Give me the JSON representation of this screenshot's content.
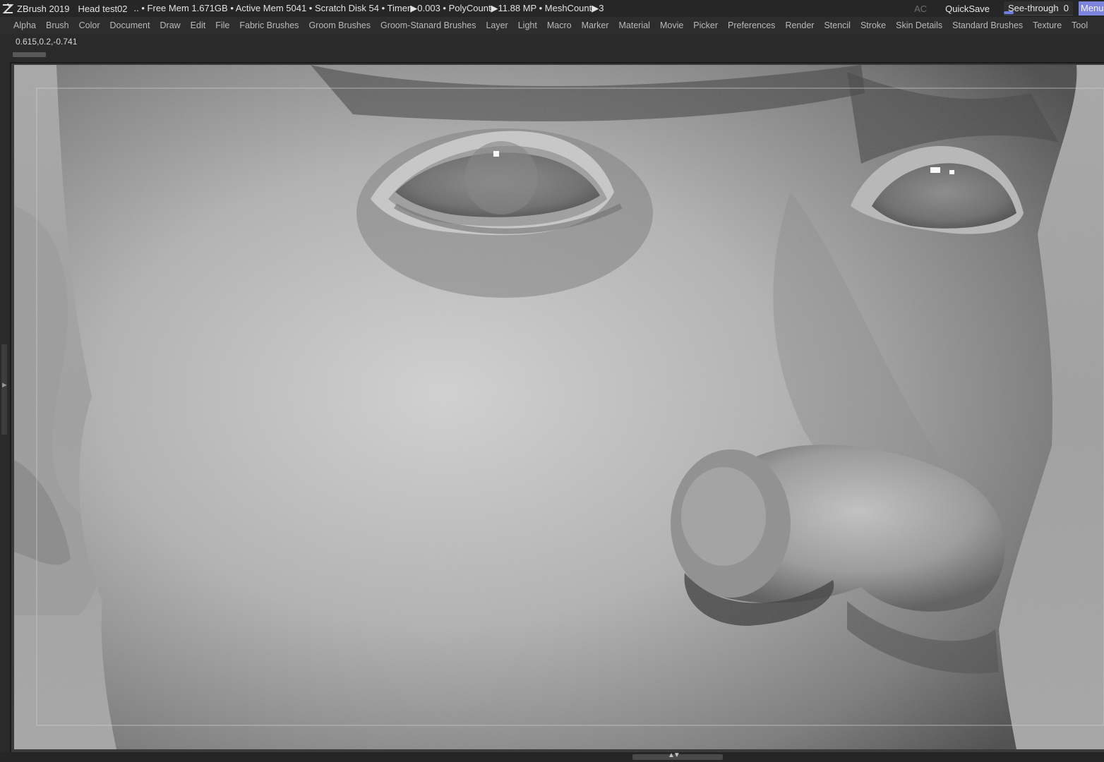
{
  "titlebar": {
    "app": "ZBrush 2019",
    "document": "Head test02",
    "stats": "..  • Free Mem 1.671GB • Active Mem 5041 • Scratch Disk 54 •  Timer▶0.003 • PolyCount▶11.88 MP  • MeshCount▶3",
    "ac_label": "AC",
    "quicksave_label": "QuickSave",
    "seethrough_label": "See-through",
    "seethrough_value": "0",
    "menus_label": "Menus",
    "logo_icon": "zbrush-logo-icon"
  },
  "menubar": {
    "items": [
      "Alpha",
      "Brush",
      "Color",
      "Document",
      "Draw",
      "Edit",
      "File",
      "Fabric Brushes",
      "Groom Brushes",
      "Groom-Stanard Brushes",
      "Layer",
      "Light",
      "Macro",
      "Marker",
      "Material",
      "Movie",
      "Picker",
      "Preferences",
      "Render",
      "Stencil",
      "Stroke",
      "Skin Details",
      "Standard Brushes",
      "Texture",
      "Tool"
    ]
  },
  "info": {
    "coords": "0.615,0.2,-0.741"
  },
  "colors": {
    "accent": "#7c84e0",
    "background": "#2a2a2a",
    "canvas": "#a5a5a5"
  }
}
